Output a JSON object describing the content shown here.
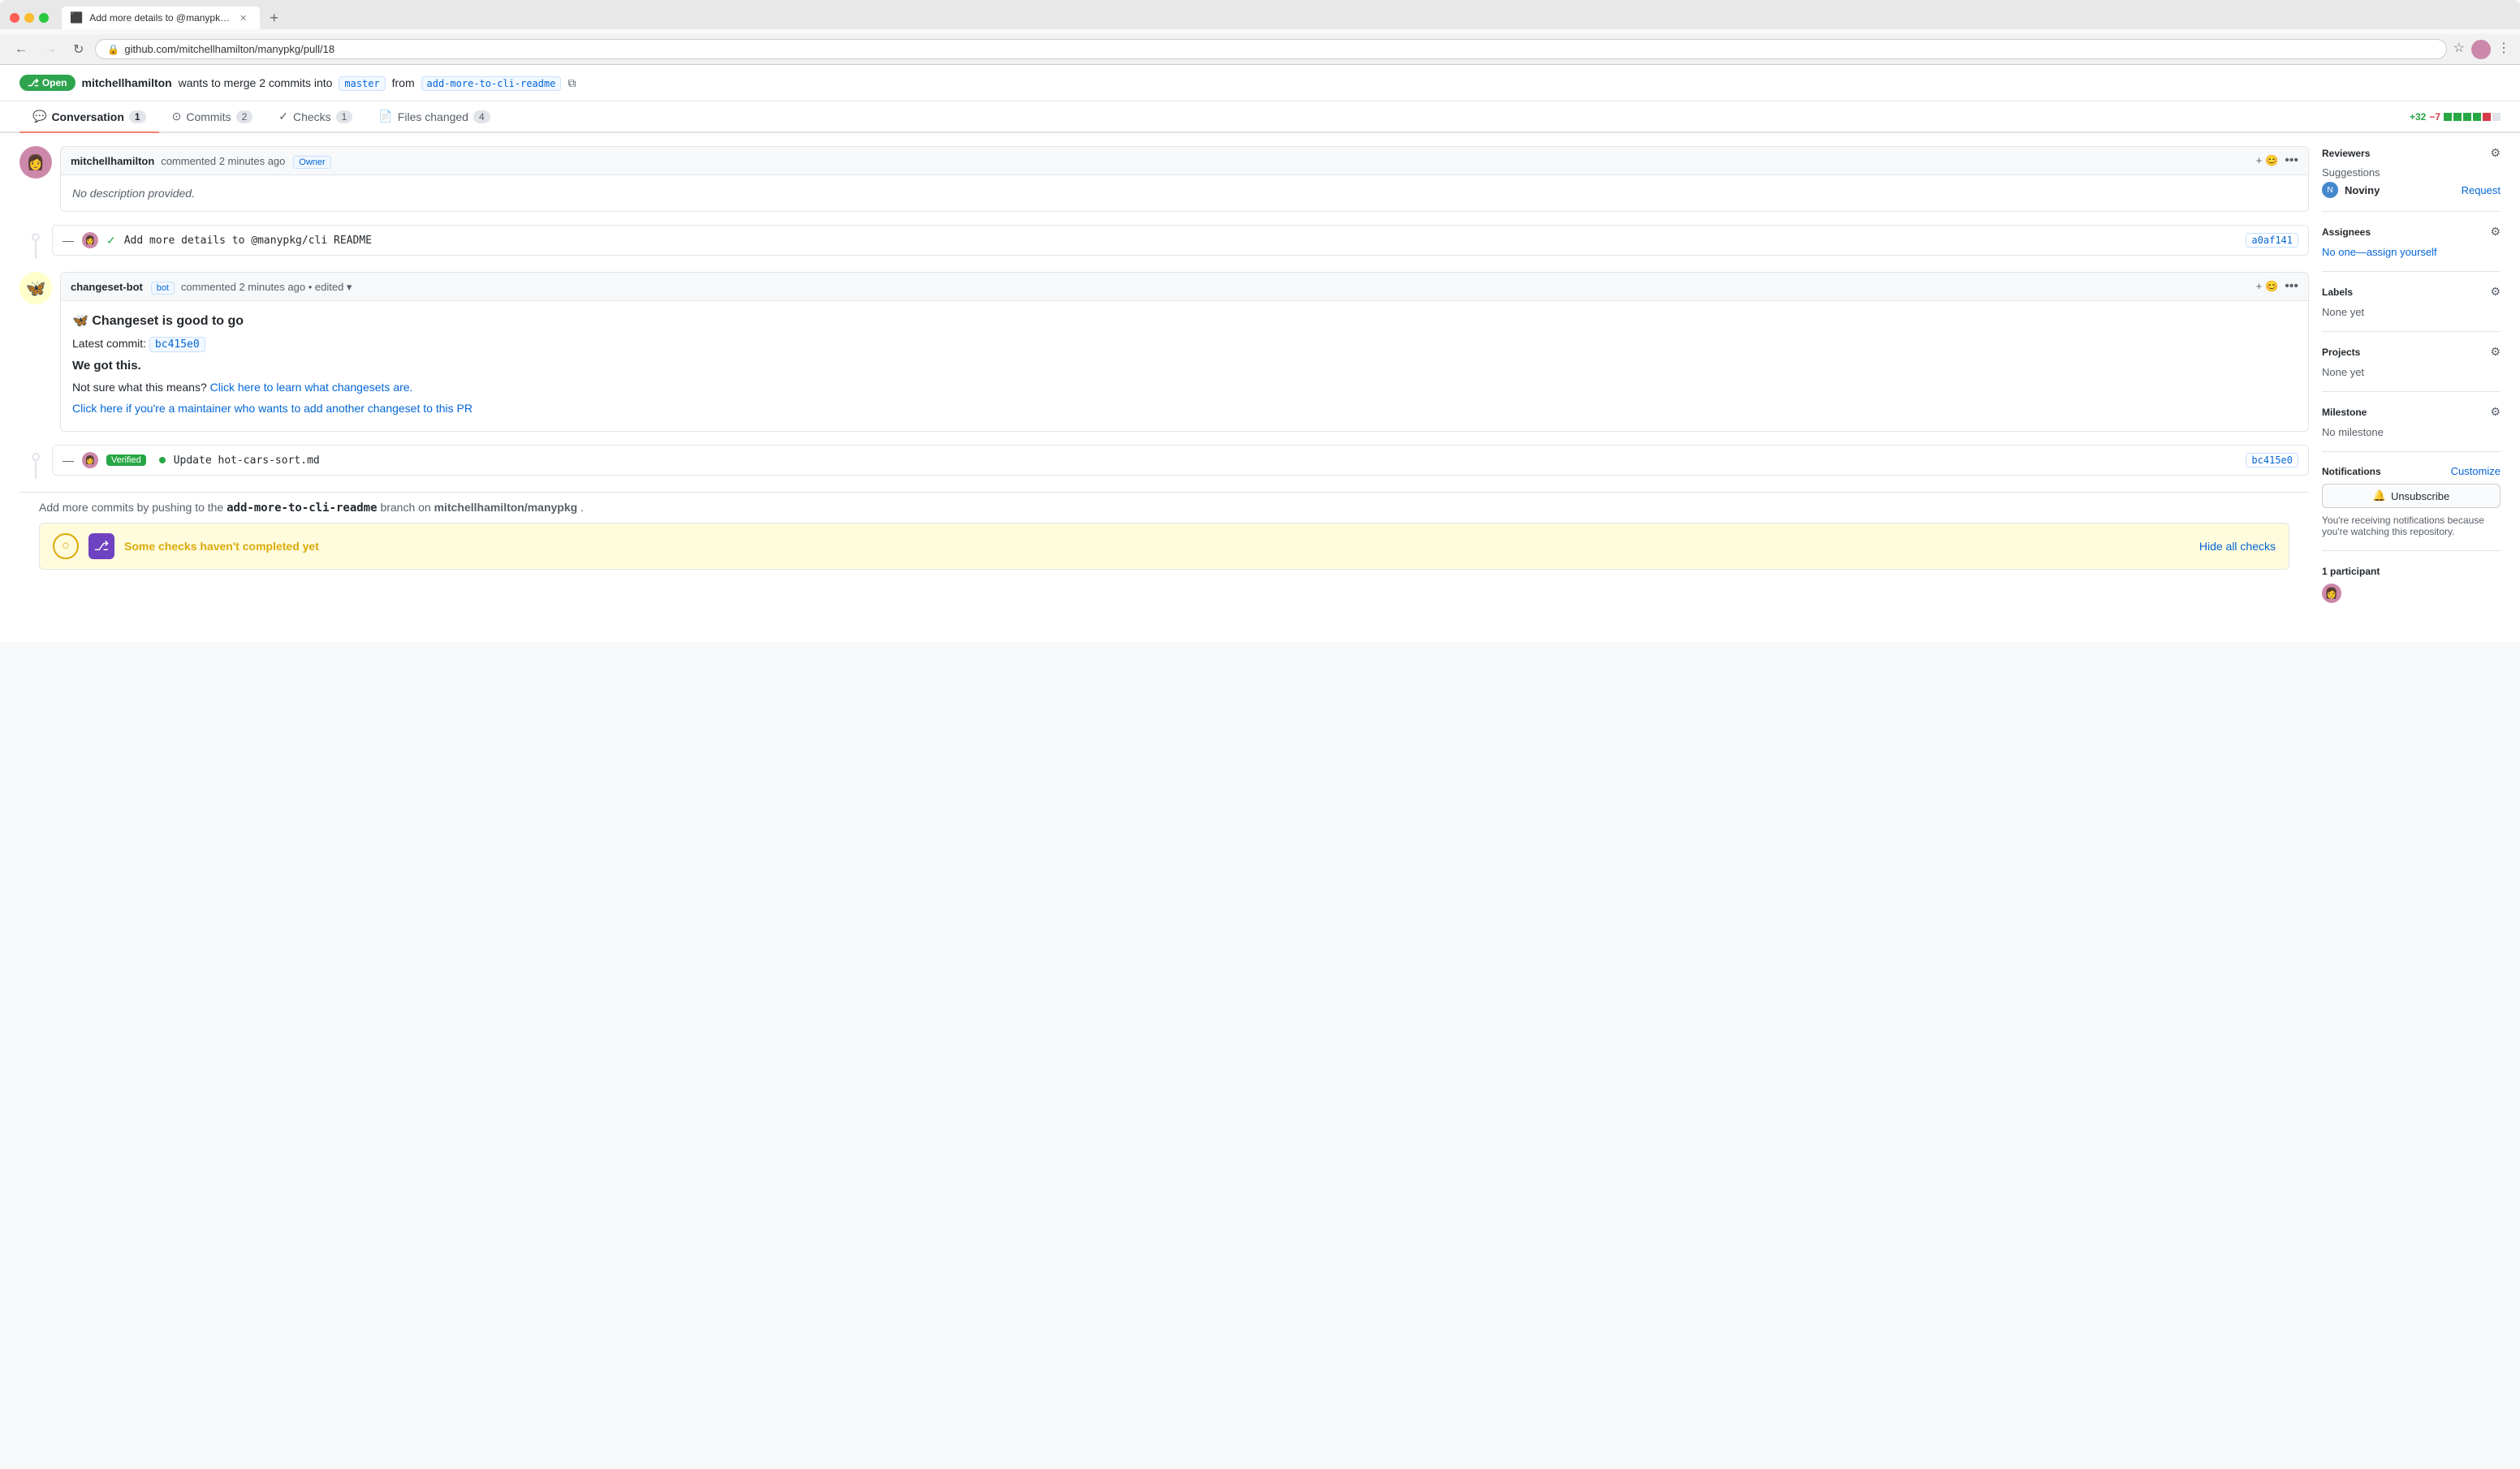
{
  "browser": {
    "tab_title": "Add more details to @manypk…",
    "url": "github.com/mitchellhamilton/manypkg/pull/18",
    "favicon": "⬛"
  },
  "pr": {
    "status": "Open",
    "author": "mitchellhamilton",
    "merge_desc": "wants to merge 2 commits into",
    "base_branch": "master",
    "from_text": "from",
    "head_branch": "add-more-to-cli-readme",
    "tabs": [
      {
        "id": "conversation",
        "label": "Conversation",
        "count": "1",
        "active": true
      },
      {
        "id": "commits",
        "label": "Commits",
        "count": "2",
        "active": false
      },
      {
        "id": "checks",
        "label": "Checks",
        "count": "1",
        "active": false
      },
      {
        "id": "files",
        "label": "Files changed",
        "count": "4",
        "active": false
      }
    ],
    "diff_stats": {
      "additions": "+32",
      "deletions": "−7",
      "bars": [
        "green",
        "green",
        "green",
        "green",
        "red",
        "gray"
      ]
    }
  },
  "comments": [
    {
      "id": "owner-comment",
      "author": "mitchellhamilton",
      "time": "commented 2 minutes ago",
      "role": "Owner",
      "body": "No description provided.",
      "is_empty": true
    },
    {
      "id": "bot-comment",
      "author": "changeset-bot",
      "role": "bot",
      "time": "commented 2 minutes ago",
      "edited": "• edited ▾",
      "title": "🦋 Changeset is good to go",
      "latest_commit_label": "Latest commit:",
      "latest_commit_sha": "bc415e0",
      "we_got_this": "We got this.",
      "not_sure": "Not sure what this means?",
      "learn_link": "Click here to learn what changesets are.",
      "maintainer_link": "Click here if you're a maintainer who wants to add another changeset to this PR"
    }
  ],
  "commits": [
    {
      "id": "commit-1",
      "message": "Add more details to @manypkg/cli README",
      "sha": "a0af141",
      "verified": false,
      "check": true
    },
    {
      "id": "commit-2",
      "message": "Update hot-cars-sort.md",
      "sha": "bc415e0",
      "verified": true
    }
  ],
  "push_note": {
    "text": "Add more commits by pushing to the",
    "branch": "add-more-to-cli-readme",
    "branch_suffix": "branch on",
    "repo": "mitchellhamilton/manypkg."
  },
  "checks_banner": {
    "text": "Some checks haven't completed yet",
    "action": "Hide all checks"
  },
  "sidebar": {
    "reviewers": {
      "title": "Reviewers",
      "suggestions_label": "Suggestions",
      "user": "Noviny",
      "request_label": "Request",
      "no_one": "No one—assign yourself"
    },
    "assignees": {
      "title": "Assignees",
      "value": "No one—assign yourself"
    },
    "labels": {
      "title": "Labels",
      "value": "None yet"
    },
    "projects": {
      "title": "Projects",
      "value": "None yet"
    },
    "milestone": {
      "title": "Milestone",
      "value": "No milestone"
    },
    "notifications": {
      "title": "Notifications",
      "customize": "Customize",
      "unsubscribe": "🔔 Unsubscribe",
      "watching_text": "You're receiving notifications because you're watching this repository."
    },
    "participants": {
      "title": "1 participant"
    }
  },
  "icons": {
    "conversation": "💬",
    "commits": "⊙",
    "checks": "✓",
    "files": "📄",
    "gear": "⚙",
    "back": "←",
    "forward": "→",
    "refresh": "↻",
    "star": "☆",
    "menu": "⋮",
    "lock": "🔒",
    "merge": "⎇",
    "bell": "🔔",
    "copy": "⧉"
  }
}
